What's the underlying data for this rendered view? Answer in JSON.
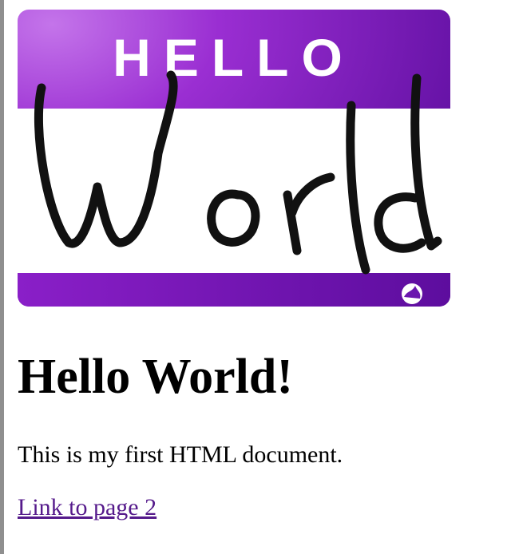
{
  "banner_image": {
    "header_text": "HELLO",
    "handwritten_text": "World",
    "colors": {
      "purple_light": "#b357e0",
      "purple_mid": "#8a1fc8",
      "purple_dark": "#4e0a8e",
      "ink": "#111111"
    }
  },
  "heading": "Hello World!",
  "paragraph": "This is my first HTML document.",
  "link": {
    "text": "Link to page 2",
    "color": "#551a8b"
  }
}
